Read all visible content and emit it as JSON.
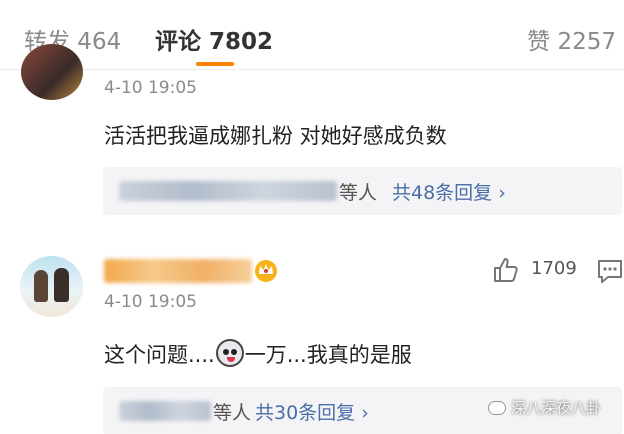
{
  "tabs": {
    "repost": "转发 464",
    "comments": "评论 7802",
    "likes": "赞 2257"
  },
  "accent_color": "#ff8200",
  "link_color": "#4a6ea8",
  "comments": [
    {
      "time": "4-10 19:05",
      "text": "活活把我逼成娜扎粉 对她好感成负数",
      "reply_suffix": "等人",
      "reply_count": "共48条回复 ›"
    },
    {
      "time": "4-10 19:05",
      "text_before": "这个问题....",
      "text_after": "一万...我真的是服",
      "emoji": "shocked-panda-emoji",
      "like_count": "1709",
      "reply_suffix": "等人",
      "reply_count": "共30条回复 ›"
    }
  ],
  "watermark": "深八深夜八卦"
}
